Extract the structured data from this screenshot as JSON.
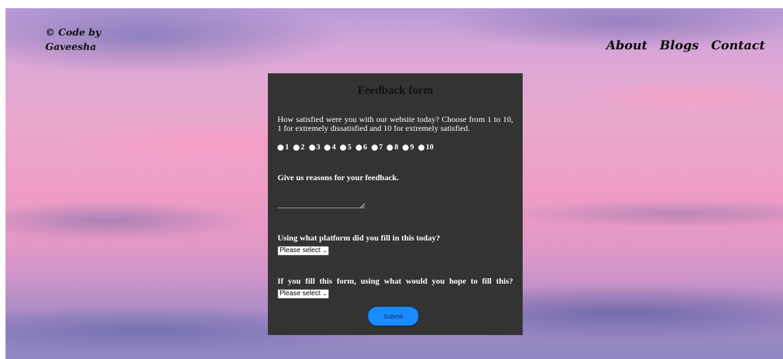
{
  "brand": {
    "line1": "© Code by",
    "line2": "Gaveesha"
  },
  "nav": {
    "items": [
      "About",
      "Blogs",
      "Contact"
    ]
  },
  "form": {
    "title": "Feedback form",
    "q1": "How satisfied were you with our website today? Choose from 1 to 10, 1 for extremely dissatisfied and 10 for extremely satisfied.",
    "ratings": [
      "1",
      "2",
      "3",
      "4",
      "5",
      "6",
      "7",
      "8",
      "9",
      "10"
    ],
    "q2": "Give us reasons for your feedback.",
    "q3": "Using what platform did you fill in this today?",
    "q3_select": "Please select",
    "q4": "If you fill this form, using what would you hope to fill this?",
    "q4_select": "Please select",
    "submit": "Submit"
  },
  "colors": {
    "card": "#333333",
    "submit": "#1a8cff"
  }
}
